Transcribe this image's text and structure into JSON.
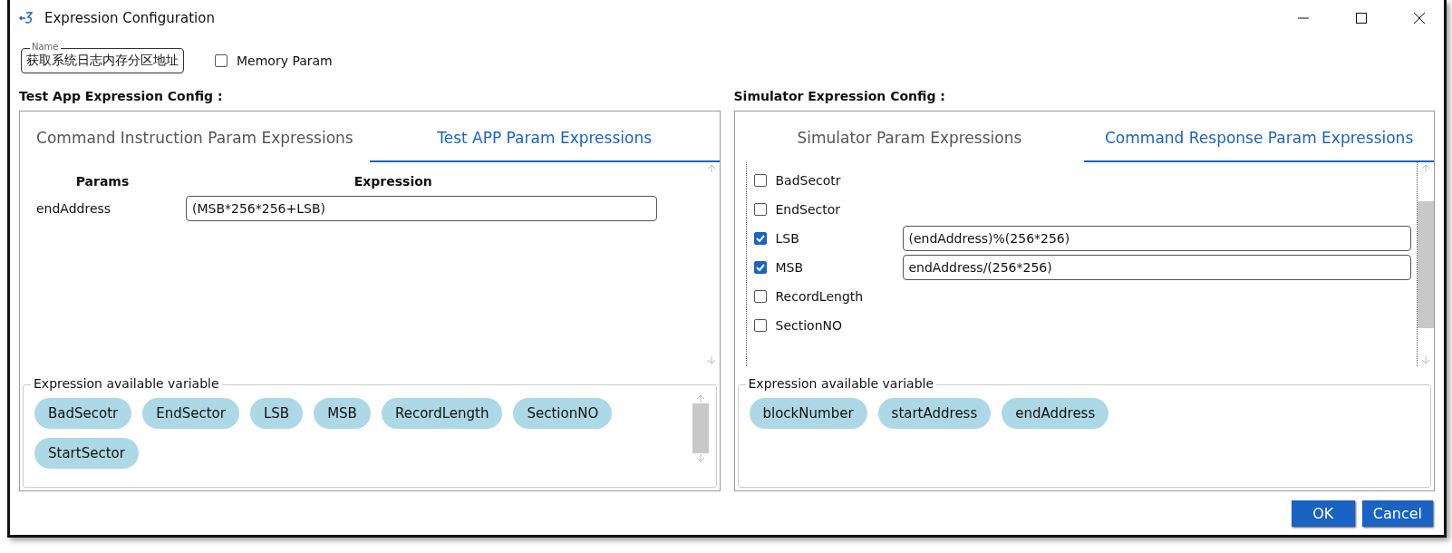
{
  "window": {
    "title": "Expression Configuration"
  },
  "name_field": {
    "label": "Name",
    "value": "获取系统日志内存分区地址"
  },
  "memory_param": {
    "label": "Memory Param",
    "checked": false
  },
  "left_panel": {
    "heading": "Test App Expression Config :",
    "tabs": [
      {
        "label": "Command Instruction Param Expressions",
        "selected": false
      },
      {
        "label": "Test APP Param Expressions",
        "selected": true
      }
    ],
    "columns": [
      "Params",
      "Expression"
    ],
    "rows": [
      {
        "param": "endAddress",
        "expression": "(MSB*256*256+LSB)"
      }
    ],
    "variables": {
      "title": "Expression available variable",
      "items": [
        "BadSecotr",
        "EndSector",
        "LSB",
        "MSB",
        "RecordLength",
        "SectionNO",
        "StartSector"
      ]
    }
  },
  "right_panel": {
    "heading": "Simulator Expression Config :",
    "tabs": [
      {
        "label": "Simulator Param Expressions",
        "selected": false
      },
      {
        "label": "Command Response Param Expressions",
        "selected": true
      }
    ],
    "params": [
      {
        "name": "BadSecotr",
        "checked": false
      },
      {
        "name": "EndSector",
        "checked": false
      },
      {
        "name": "LSB",
        "checked": true,
        "expression": "(endAddress)%(256*256)"
      },
      {
        "name": "MSB",
        "checked": true,
        "expression": "endAddress/(256*256)"
      },
      {
        "name": "RecordLength",
        "checked": false
      },
      {
        "name": "SectionNO",
        "checked": false
      }
    ],
    "variables": {
      "title": "Expression available variable",
      "items": [
        "blockNumber",
        "startAddress",
        "endAddress"
      ]
    }
  },
  "buttons": [
    {
      "label": "OK"
    },
    {
      "label": "Cancel"
    }
  ]
}
